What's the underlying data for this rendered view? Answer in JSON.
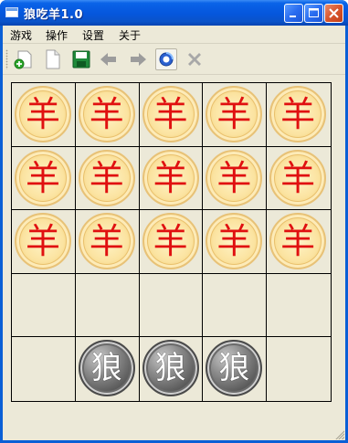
{
  "window": {
    "title": "狼吃羊1.0",
    "accent": "#0556dc"
  },
  "menu": {
    "items": [
      {
        "label": "游戏"
      },
      {
        "label": "操作"
      },
      {
        "label": "设置"
      },
      {
        "label": "关于"
      }
    ]
  },
  "toolbar": {
    "tools": [
      {
        "name": "new-game-icon"
      },
      {
        "name": "blank-page-icon"
      },
      {
        "name": "save-icon"
      },
      {
        "name": "undo-arrow-left-icon"
      },
      {
        "name": "redo-arrow-right-icon"
      },
      {
        "name": "refresh-icon",
        "pressed": true
      },
      {
        "name": "close-x-icon"
      }
    ]
  },
  "board": {
    "rows": 5,
    "cols": 5,
    "sheep_glyph": "羊",
    "wolf_glyph": "狼",
    "cells": [
      [
        "sheep",
        "sheep",
        "sheep",
        "sheep",
        "sheep"
      ],
      [
        "sheep",
        "sheep",
        "sheep",
        "sheep",
        "sheep"
      ],
      [
        "sheep",
        "sheep",
        "sheep",
        "sheep",
        "sheep"
      ],
      [
        "",
        "",
        "",
        "",
        ""
      ],
      [
        "",
        "wolf",
        "wolf",
        "wolf",
        ""
      ]
    ],
    "colors": {
      "sheep_text": "#e01010",
      "sheep_face": "#fbe3a0",
      "wolf_face": "#6a6a6a",
      "grid_line": "#000000",
      "background": "#ece9d8"
    }
  }
}
